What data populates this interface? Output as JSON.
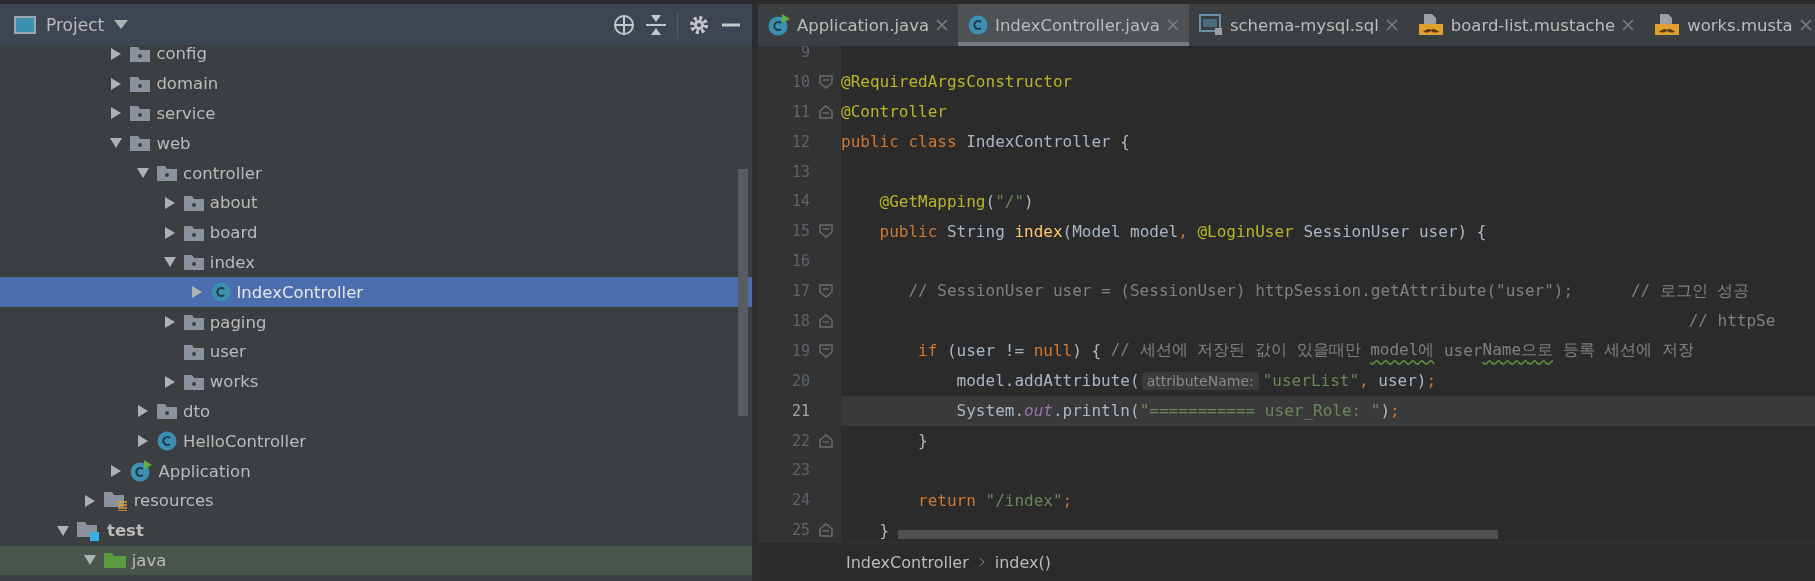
{
  "project_panel": {
    "title": "Project",
    "tree": [
      {
        "children": [
          {
            "children": [
              {
                "label": "config",
                "kind": "package",
                "expanded": false,
                "selected": false
              },
              {
                "label": "domain",
                "kind": "package",
                "expanded": false,
                "selected": false
              },
              {
                "label": "service",
                "kind": "package",
                "expanded": false,
                "selected": false
              },
              {
                "label": "web",
                "kind": "package",
                "expanded": true,
                "selected": false,
                "children": [
                  {
                    "label": "controller",
                    "kind": "package",
                    "expanded": true,
                    "selected": false,
                    "children": [
                      {
                        "label": "about",
                        "kind": "package",
                        "expanded": false,
                        "selected": false
                      },
                      {
                        "label": "board",
                        "kind": "package",
                        "expanded": false,
                        "selected": false
                      },
                      {
                        "label": "index",
                        "kind": "package",
                        "expanded": true,
                        "selected": false,
                        "children": [
                          {
                            "label": "IndexController",
                            "kind": "class",
                            "expanded": false,
                            "selected": true
                          }
                        ]
                      },
                      {
                        "label": "paging",
                        "kind": "package",
                        "expanded": false,
                        "selected": false
                      },
                      {
                        "label": "user",
                        "kind": "package",
                        "selected": false
                      },
                      {
                        "label": "works",
                        "kind": "package",
                        "expanded": false,
                        "selected": false
                      }
                    ]
                  },
                  {
                    "label": "dto",
                    "kind": "package",
                    "expanded": false,
                    "selected": false
                  },
                  {
                    "label": "HelloController",
                    "kind": "class",
                    "expanded": false,
                    "selected": false
                  }
                ]
              },
              {
                "label": "Application",
                "kind": "app",
                "expanded": false,
                "selected": false
              }
            ]
          },
          {
            "label": "resources",
            "kind": "resources",
            "expanded": false,
            "selected": false
          }
        ]
      },
      {
        "label": "test",
        "kind": "test-root",
        "expanded": true,
        "selected": false,
        "children": [
          {
            "label": "java",
            "kind": "test-source",
            "expanded": true,
            "selected": false
          }
        ]
      }
    ]
  },
  "editor": {
    "tabs": [
      {
        "label": "Application.java",
        "kind": "app",
        "selected": false
      },
      {
        "label": "IndexController.java",
        "kind": "class",
        "selected": true
      },
      {
        "label": "schema-mysql.sql",
        "kind": "sql",
        "selected": false
      },
      {
        "label": "board-list.mustache",
        "kind": "mustache",
        "selected": false
      },
      {
        "label": "works.musta",
        "kind": "mustache",
        "selected": false
      }
    ],
    "lines": [
      {
        "number": "9",
        "current": false,
        "fold_start": false,
        "fold_end": false
      },
      {
        "number": "10",
        "current": false,
        "fold_start": true,
        "fold_end": false,
        "tokens": [
          {
            "kind": "annotation",
            "text": "@RequiredArgsConstructor"
          }
        ]
      },
      {
        "number": "11",
        "current": false,
        "fold_start": false,
        "fold_end": true,
        "tokens": [
          {
            "kind": "annotation",
            "text": "@Controller"
          }
        ]
      },
      {
        "number": "12",
        "current": false,
        "fold_start": false,
        "fold_end": false,
        "tokens": [
          {
            "kind": "keyword",
            "text": "public class"
          },
          {
            "kind": "plain",
            "text": " IndexController {"
          }
        ]
      },
      {
        "number": "13",
        "current": false,
        "fold_start": false,
        "fold_end": false
      },
      {
        "number": "14",
        "current": false,
        "fold_start": false,
        "fold_end": false,
        "tokens": [
          {
            "kind": "annotation",
            "text": "    @GetMapping"
          },
          {
            "kind": "plain",
            "text": "("
          },
          {
            "kind": "string",
            "text": "\"/\""
          },
          {
            "kind": "plain",
            "text": ")"
          }
        ]
      },
      {
        "number": "15",
        "current": false,
        "fold_start": true,
        "fold_end": false,
        "tokens": [
          {
            "kind": "keyword",
            "text": "    public"
          },
          {
            "kind": "plain",
            "text": " String "
          },
          {
            "kind": "method",
            "text": "index"
          },
          {
            "kind": "plain",
            "text": "(Model model"
          },
          {
            "kind": "keyword",
            "text": ", "
          },
          {
            "kind": "annotation",
            "text": "@LoginUser"
          },
          {
            "kind": "plain",
            "text": " SessionUser user) {"
          }
        ]
      },
      {
        "number": "16",
        "current": false,
        "fold_start": false,
        "fold_end": false
      },
      {
        "number": "17",
        "current": false,
        "fold_start": true,
        "fold_end": false,
        "tokens": [
          {
            "kind": "comment",
            "text": "       // SessionUser user = (SessionUser) httpSession.getAttribute(\"user\");      // 로그인 성공"
          }
        ]
      },
      {
        "number": "18",
        "current": false,
        "fold_start": false,
        "fold_end": true,
        "tokens": [
          {
            "kind": "comment",
            "text": "                                                                                        // httpSe"
          }
        ]
      },
      {
        "number": "19",
        "current": false,
        "fold_start": true,
        "fold_end": false,
        "tokens": [
          {
            "kind": "keyword",
            "text": "        if"
          },
          {
            "kind": "plain",
            "text": " (user != "
          },
          {
            "kind": "keyword",
            "text": "null"
          },
          {
            "kind": "plain",
            "text": ") { "
          },
          {
            "kind": "comment",
            "text": "// 세션에 저장된 값이 있을때만 "
          },
          {
            "kind": "typo",
            "text": "model에"
          },
          {
            "kind": "comment",
            "text": " user"
          },
          {
            "kind": "typo",
            "text": "Name으로"
          },
          {
            "kind": "comment",
            "text": " 등록 세션에 저장"
          }
        ]
      },
      {
        "number": "20",
        "current": false,
        "fold_start": false,
        "fold_end": false,
        "tokens": [
          {
            "kind": "plain",
            "text": "            model.addAttribute("
          },
          {
            "kind": "hint",
            "text": "attributeName:"
          },
          {
            "kind": "string",
            "text": "\"userList\""
          },
          {
            "kind": "keyword",
            "text": ", "
          },
          {
            "kind": "plain",
            "text": "user)"
          },
          {
            "kind": "keyword",
            "text": ";"
          }
        ]
      },
      {
        "number": "21",
        "current": true,
        "fold_start": false,
        "fold_end": false,
        "tokens": [
          {
            "kind": "plain",
            "text": "            System."
          },
          {
            "kind": "static",
            "text": "out"
          },
          {
            "kind": "plain",
            "text": ".println("
          },
          {
            "kind": "string",
            "text": "\"=========== user_Role: \""
          },
          {
            "kind": "plain",
            "text": ")"
          },
          {
            "kind": "keyword",
            "text": ";"
          }
        ]
      },
      {
        "number": "22",
        "current": false,
        "fold_start": false,
        "fold_end": true,
        "tokens": [
          {
            "kind": "plain",
            "text": "        }"
          }
        ]
      },
      {
        "number": "23",
        "current": false,
        "fold_start": false,
        "fold_end": false
      },
      {
        "number": "24",
        "current": false,
        "fold_start": false,
        "fold_end": false,
        "tokens": [
          {
            "kind": "keyword",
            "text": "        return "
          },
          {
            "kind": "string",
            "text": "\"/index\""
          },
          {
            "kind": "keyword",
            "text": ";"
          }
        ]
      },
      {
        "number": "25",
        "current": false,
        "fold_start": false,
        "fold_end": true,
        "tokens": [
          {
            "kind": "plain",
            "text": "    }"
          }
        ]
      }
    ],
    "breadcrumbs": [
      "IndexController",
      "index()"
    ]
  }
}
